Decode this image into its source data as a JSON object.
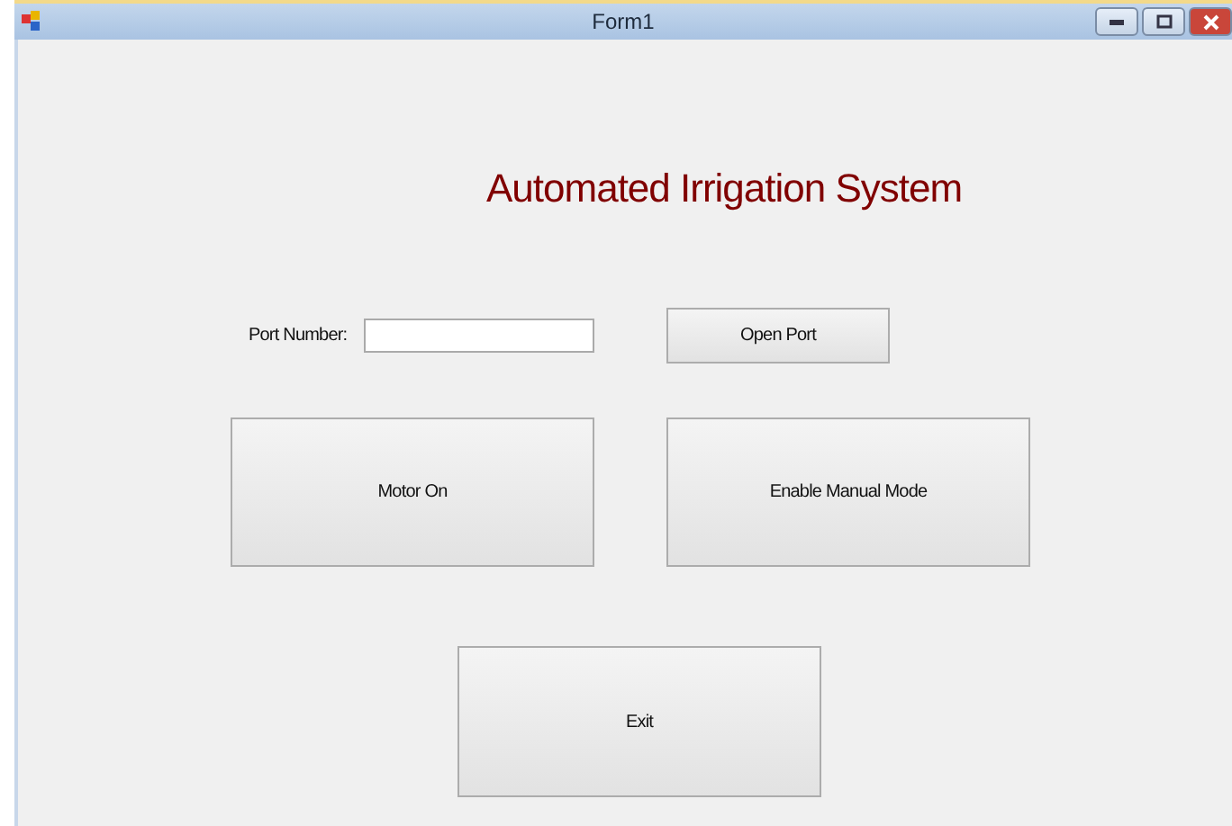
{
  "window": {
    "title": "Form1"
  },
  "heading": "Automated Irrigation System",
  "port": {
    "label": "Port Number:"
  },
  "buttons": {
    "open_port": "Open Port",
    "motor": "Motor On",
    "manual": "Enable Manual Mode",
    "exit": "Exit"
  }
}
